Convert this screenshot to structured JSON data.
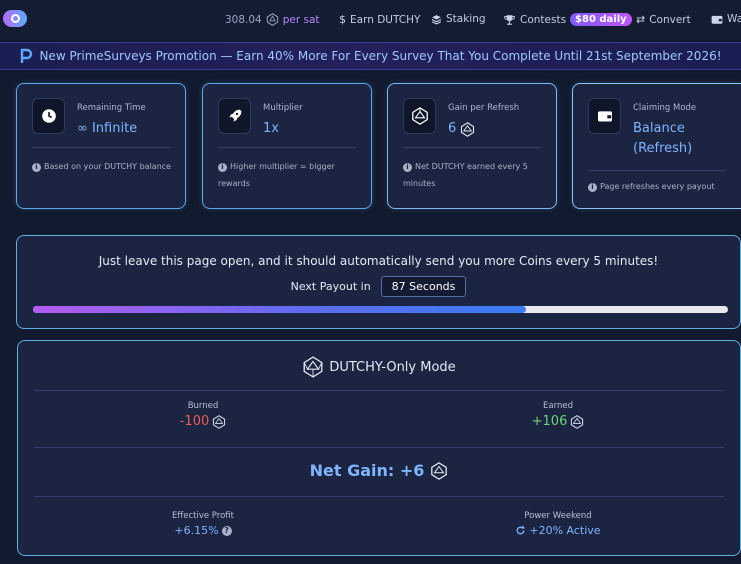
{
  "nav": {
    "balance": "308.04",
    "per_sat": "per sat",
    "earn": "Earn DUTCHY",
    "staking": "Staking",
    "contests": "Contests",
    "contests_badge": "$80 daily",
    "convert": "Convert",
    "wallet": "Wal"
  },
  "promo": {
    "text": "New PrimeSurveys Promotion — Earn 40% More For Every Survey That You Complete Until 21st September 2026!"
  },
  "cards": [
    {
      "label": "Remaining Time",
      "value": "∞ Infinite",
      "note": "Based on your DUTCHY balance"
    },
    {
      "label": "Multiplier",
      "value": "1x",
      "note": "Higher multiplier = bigger rewards"
    },
    {
      "label": "Gain per Refresh",
      "value": "6",
      "note": "Net DUTCHY earned every 5 minutes"
    },
    {
      "label": "Claiming Mode",
      "value": "Balance (Refresh)",
      "note": "Page refreshes every payout"
    }
  ],
  "payout": {
    "message": "Just leave this page open, and it should automatically send you more Coins every 5 minutes!",
    "next_label": "Next Payout in",
    "seconds": "87 Seconds",
    "progress": 0.71
  },
  "dutchy": {
    "title": "DUTCHY-Only Mode",
    "burned_label": "Burned",
    "burned_value": "-100",
    "earned_label": "Earned",
    "earned_value": "+106",
    "net_gain": "Net Gain: +6",
    "effective_label": "Effective Profit",
    "effective_value": "+6.15%",
    "weekend_label": "Power Weekend",
    "weekend_value": "+20% Active"
  },
  "colors": {
    "accent": "#7fb4ff",
    "negative": "#ef5a5a",
    "positive": "#6fd27a",
    "badge": "#9b5cff"
  }
}
